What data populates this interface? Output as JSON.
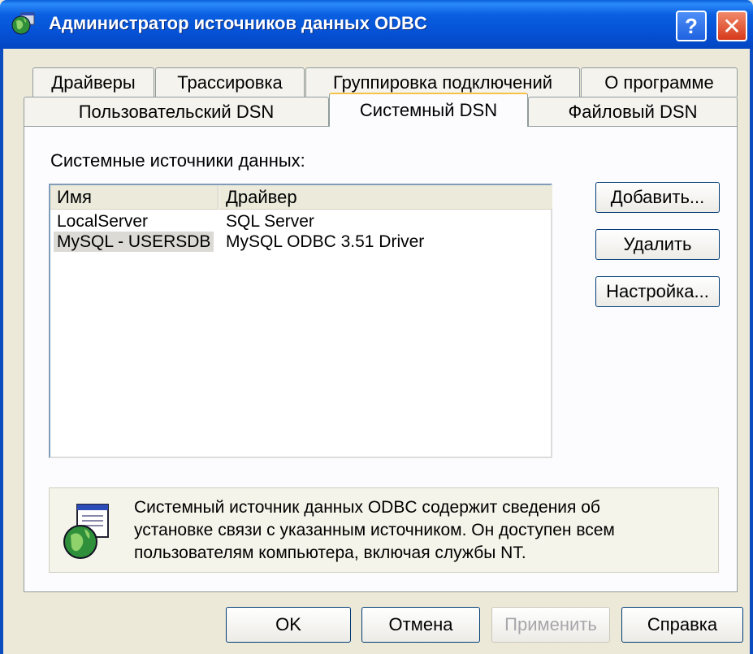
{
  "window": {
    "title": "Администратор источников данных ODBC",
    "help_glyph": "?",
    "close_glyph": "✕"
  },
  "tabs_row1": [
    {
      "label": "Драйверы"
    },
    {
      "label": "Трассировка"
    },
    {
      "label": "Группировка подключений"
    },
    {
      "label": "О программе"
    }
  ],
  "tabs_row2": [
    {
      "label": "Пользовательский DSN"
    },
    {
      "label": "Системный DSN",
      "active": true
    },
    {
      "label": "Файловый DSN"
    }
  ],
  "panel": {
    "section_label": "Системные источники данных:",
    "list": {
      "columns": [
        "Имя",
        "Драйвер"
      ],
      "rows": [
        {
          "name": "LocalServer",
          "driver": "SQL Server"
        },
        {
          "name": "MySQL - USERSDB",
          "driver": "MySQL ODBC 3.51 Driver",
          "selected": true
        }
      ]
    },
    "buttons": {
      "add": "Добавить...",
      "remove": "Удалить",
      "configure": "Настройка..."
    },
    "info": {
      "line1": "Системный источник данных ODBC содержит сведения об",
      "line2": "установке связи с указанным источником. Он доступен всем",
      "line3": "пользователям компьютера, включая службы NT."
    }
  },
  "footer": {
    "ok": "OK",
    "cancel": "Отмена",
    "apply": "Применить",
    "help": "Справка"
  },
  "colors": {
    "titlebar": "#0a5fe0",
    "dialog_bg": "#ece9d8",
    "active_tab_accent": "#f7c24a"
  }
}
